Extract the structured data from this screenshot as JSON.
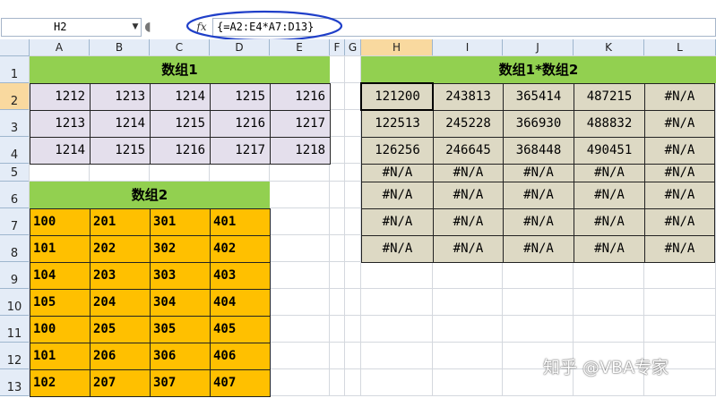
{
  "formula_bar": {
    "name_box": "H2",
    "fx_label": "fx",
    "formula": "{=A2:E4*A7:D13}"
  },
  "columns": [
    "A",
    "B",
    "C",
    "D",
    "E",
    "F",
    "G",
    "H",
    "I",
    "J",
    "K",
    "L"
  ],
  "rows": [
    "1",
    "2",
    "3",
    "4",
    "5",
    "6",
    "7",
    "8",
    "9",
    "10",
    "11",
    "12",
    "13"
  ],
  "selected": {
    "column": "H",
    "row": "2"
  },
  "array1": {
    "title": "数组1",
    "values": [
      [
        "1212",
        "1213",
        "1214",
        "1215",
        "1216"
      ],
      [
        "1213",
        "1214",
        "1215",
        "1216",
        "1217"
      ],
      [
        "1214",
        "1215",
        "1216",
        "1217",
        "1218"
      ]
    ]
  },
  "array2": {
    "title": "数组2",
    "values": [
      [
        "100",
        "201",
        "301",
        "401"
      ],
      [
        "101",
        "202",
        "302",
        "402"
      ],
      [
        "104",
        "203",
        "303",
        "403"
      ],
      [
        "105",
        "204",
        "304",
        "404"
      ],
      [
        "100",
        "205",
        "305",
        "405"
      ],
      [
        "101",
        "206",
        "306",
        "406"
      ],
      [
        "102",
        "207",
        "307",
        "407"
      ]
    ]
  },
  "result": {
    "title": "数组1*数组2",
    "values": [
      [
        "121200",
        "243813",
        "365414",
        "487215",
        "#N/A"
      ],
      [
        "122513",
        "245228",
        "366930",
        "488832",
        "#N/A"
      ],
      [
        "126256",
        "246645",
        "368448",
        "490451",
        "#N/A"
      ],
      [
        "#N/A",
        "#N/A",
        "#N/A",
        "#N/A",
        "#N/A"
      ],
      [
        "#N/A",
        "#N/A",
        "#N/A",
        "#N/A",
        "#N/A"
      ],
      [
        "#N/A",
        "#N/A",
        "#N/A",
        "#N/A",
        "#N/A"
      ],
      [
        "#N/A",
        "#N/A",
        "#N/A",
        "#N/A",
        "#N/A"
      ]
    ]
  },
  "watermark": "知乎 @VBA专家",
  "colors": {
    "green": "#92d050",
    "lavender": "#e4dfec",
    "orange": "#ffc000",
    "tan": "#ddd9c4",
    "annotation": "#1f3fc9"
  }
}
